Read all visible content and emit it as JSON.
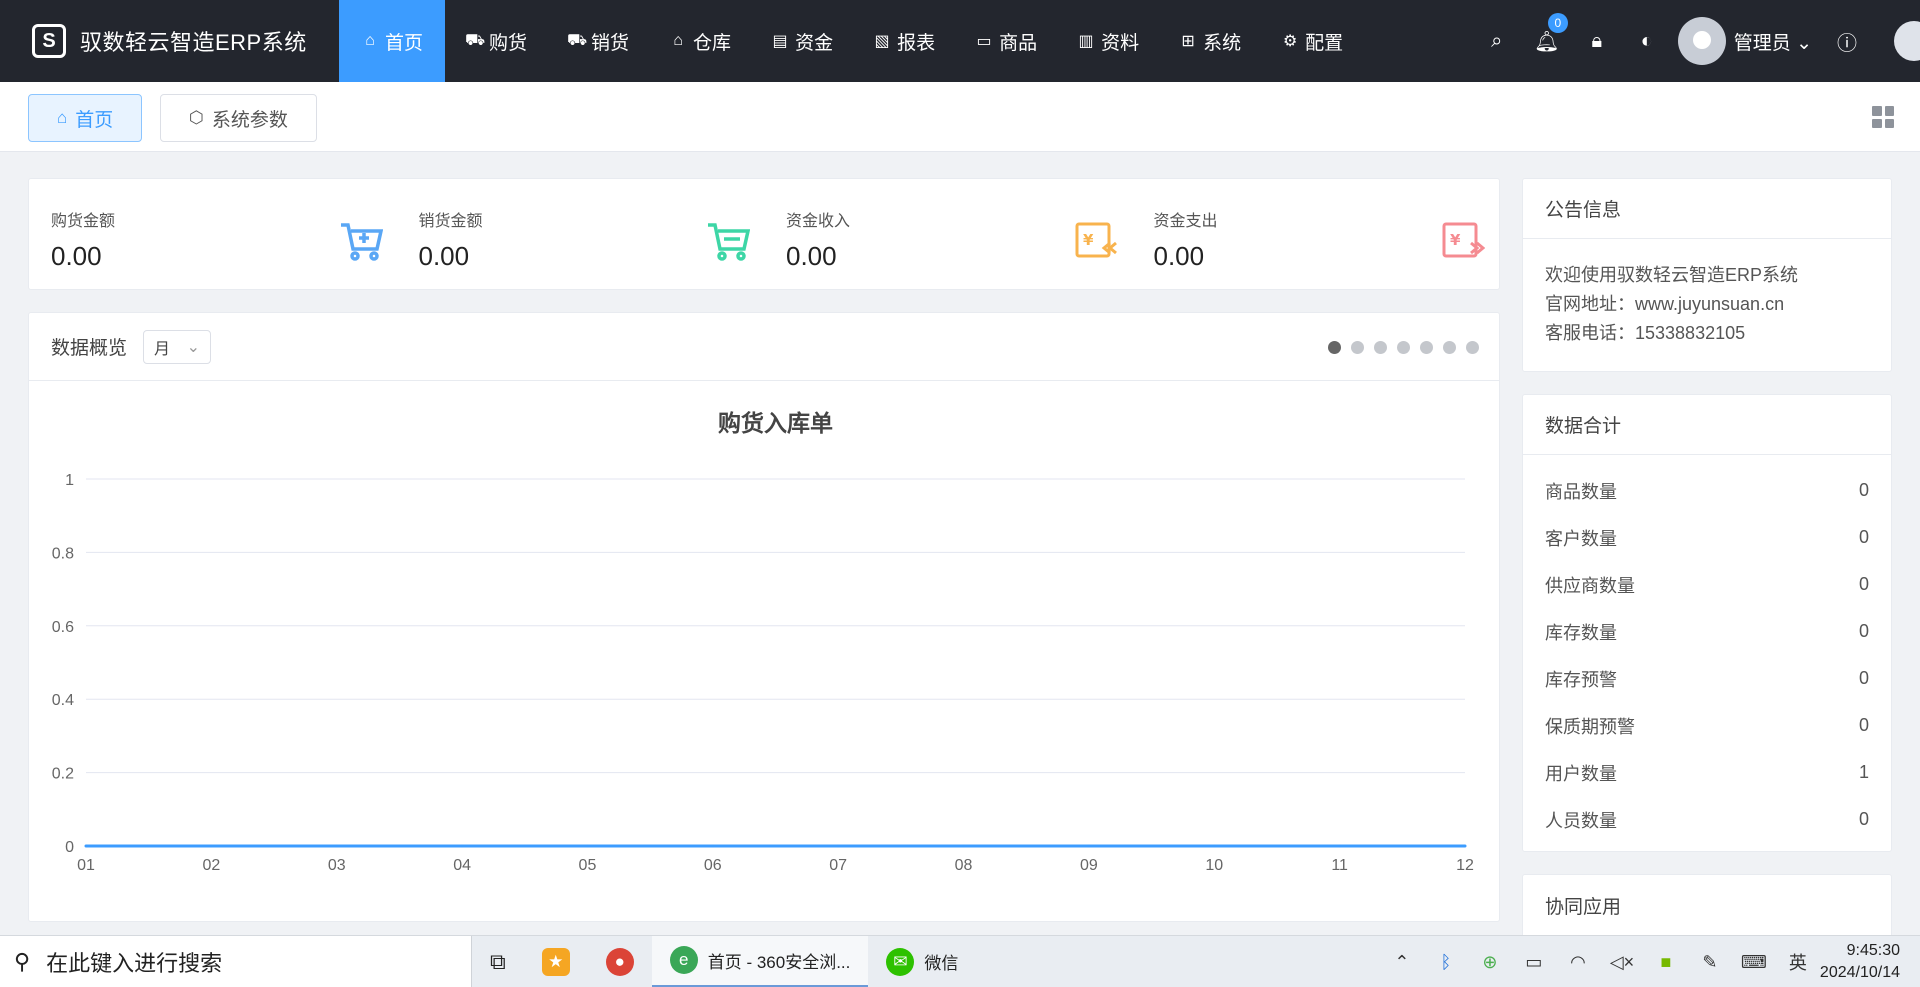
{
  "app": {
    "title": "驭数轻云智造ERP系统",
    "logo_glyph": "S"
  },
  "nav": [
    {
      "label": "首页",
      "icon": "home-icon",
      "glyph": "⌂",
      "active": true
    },
    {
      "label": "购货",
      "icon": "cart-icon",
      "glyph": "⛟",
      "active": false
    },
    {
      "label": "销货",
      "icon": "cart-outline-icon",
      "glyph": "⛟",
      "active": false
    },
    {
      "label": "仓库",
      "icon": "warehouse-icon",
      "glyph": "⌂",
      "active": false
    },
    {
      "label": "资金",
      "icon": "coins-icon",
      "glyph": "▤",
      "active": false
    },
    {
      "label": "报表",
      "icon": "report-icon",
      "glyph": "▧",
      "active": false
    },
    {
      "label": "商品",
      "icon": "goods-icon",
      "glyph": "▭",
      "active": false
    },
    {
      "label": "资料",
      "icon": "books-icon",
      "glyph": "▥",
      "active": false
    },
    {
      "label": "系统",
      "icon": "grid-icon",
      "glyph": "⊞",
      "active": false
    },
    {
      "label": "配置",
      "icon": "gear-icon",
      "glyph": "⚙",
      "active": false
    }
  ],
  "top_right": {
    "notification_count": "0",
    "user_name": "管理员"
  },
  "tabs": [
    {
      "label": "首页",
      "icon": "home-icon",
      "glyph": "⌂",
      "active": true
    },
    {
      "label": "系统参数",
      "icon": "settings-hexagon-icon",
      "glyph": "⬡",
      "active": false
    }
  ],
  "stats": [
    {
      "label": "购货金额",
      "value": "0.00",
      "icon": "cart-plus-icon",
      "color": "#5aa7f5"
    },
    {
      "label": "销货金额",
      "value": "0.00",
      "icon": "cart-icon",
      "color": "#3dd6a6"
    },
    {
      "label": "资金收入",
      "value": "0.00",
      "icon": "yen-in-icon",
      "color": "#f8b34d"
    },
    {
      "label": "资金支出",
      "value": "0.00",
      "icon": "yen-out-icon",
      "color": "#f58b91"
    }
  ],
  "overview": {
    "title": "数据概览",
    "period": "月",
    "carousel_pages": 7,
    "active_page": 0
  },
  "chart_data": {
    "type": "line",
    "title": "购货入库单",
    "categories": [
      "01",
      "02",
      "03",
      "04",
      "05",
      "06",
      "07",
      "08",
      "09",
      "10",
      "11",
      "12"
    ],
    "series": [
      {
        "values": [
          0,
          0,
          0,
          0,
          0,
          0,
          0,
          0,
          0,
          0,
          0,
          0
        ]
      }
    ],
    "y_ticks": [
      "0",
      "0.2",
      "0.4",
      "0.6",
      "0.8",
      "1"
    ],
    "ylim": [
      0,
      1
    ],
    "grid": true,
    "line_color": "#3c9cff"
  },
  "notice": {
    "title": "公告信息",
    "lines": [
      "欢迎使用驭数轻云智造ERP系统",
      "官网地址：www.juyunsuan.cn",
      "客服电话：15338832105"
    ]
  },
  "totals": {
    "title": "数据合计",
    "rows": [
      {
        "label": "商品数量",
        "value": "0"
      },
      {
        "label": "客户数量",
        "value": "0"
      },
      {
        "label": "供应商数量",
        "value": "0"
      },
      {
        "label": "库存数量",
        "value": "0"
      },
      {
        "label": "库存预警",
        "value": "0"
      },
      {
        "label": "保质期预警",
        "value": "0"
      },
      {
        "label": "用户数量",
        "value": "1"
      },
      {
        "label": "人员数量",
        "value": "0"
      }
    ]
  },
  "collab": {
    "title": "协同应用"
  },
  "taskbar": {
    "search_placeholder": "在此键入进行搜索",
    "apps": [
      {
        "label": "首页 - 360安全浏...",
        "icon": "ie-browser-icon",
        "active": true
      },
      {
        "label": "微信",
        "icon": "wechat-icon",
        "active": false
      }
    ],
    "ime": "英",
    "time": "9:45:30",
    "date": "2024/10/14"
  }
}
